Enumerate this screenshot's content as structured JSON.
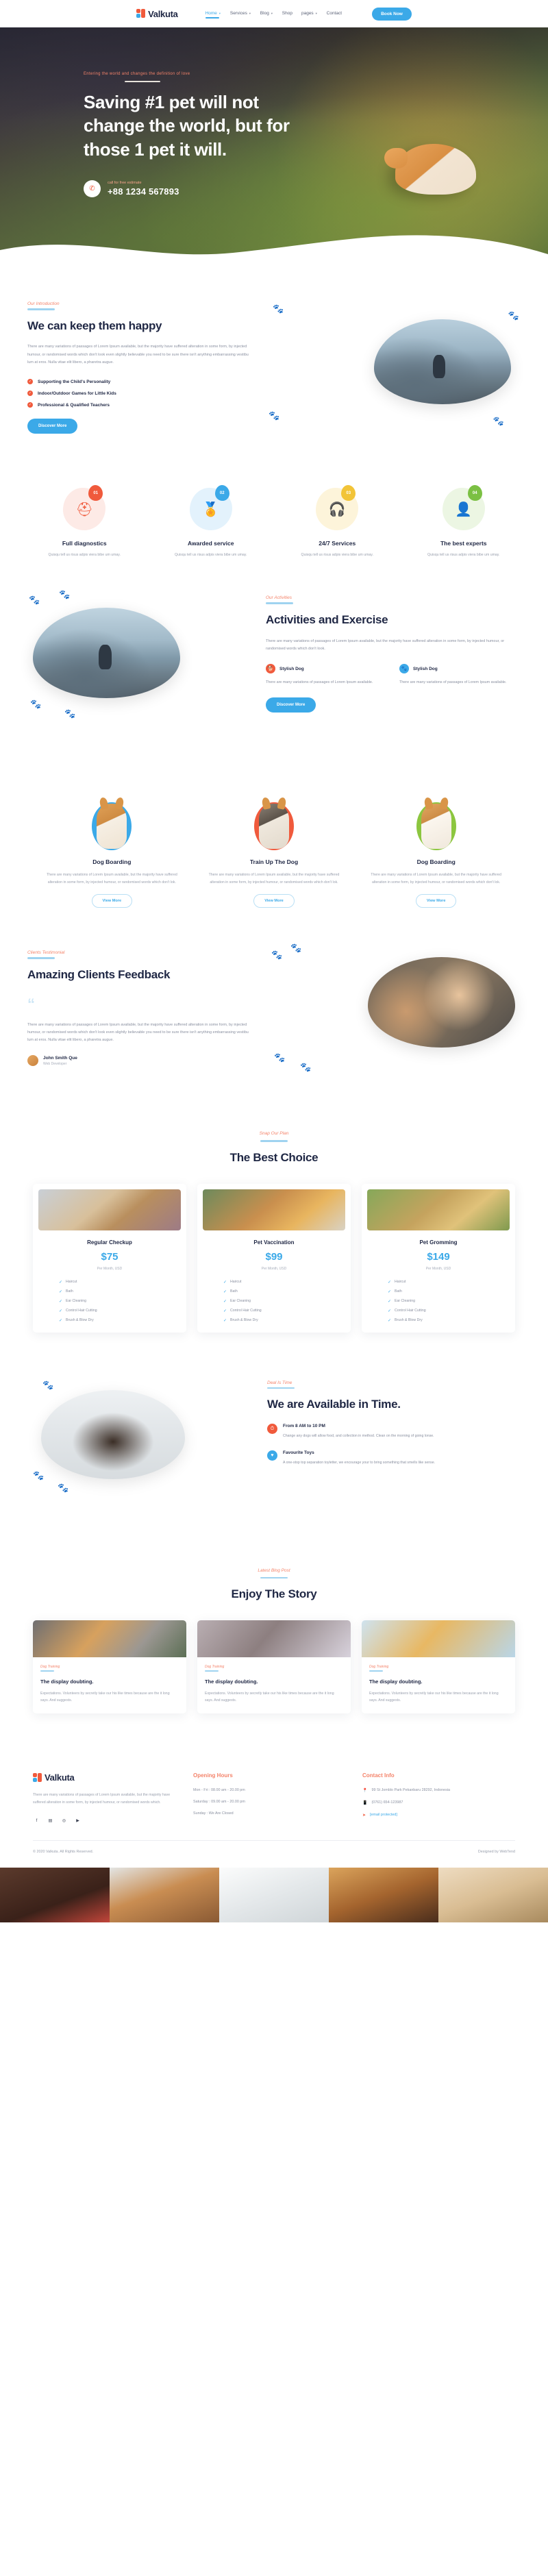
{
  "header": {
    "logo": "Valkuta",
    "nav": [
      {
        "label": "Home",
        "caret": true,
        "active": true
      },
      {
        "label": "Services",
        "caret": true,
        "active": false
      },
      {
        "label": "Blog",
        "caret": true,
        "active": false
      },
      {
        "label": "Shop",
        "caret": false,
        "active": false
      },
      {
        "label": "pages",
        "caret": true,
        "active": false
      },
      {
        "label": "Contact",
        "caret": false,
        "active": false
      }
    ],
    "book_label": "Book Now"
  },
  "hero": {
    "eyebrow": "Entering the world and changes the definition of love",
    "title": "Saving #1 pet will not change the world, but for those 1 pet it will.",
    "phone_label": "call for free estimate",
    "phone_number": "+88 1234 567893",
    "phone_icon": "phone-icon"
  },
  "intro": {
    "eyebrow": "Our Introduction",
    "title": "We can keep them happy",
    "body": "There are many variations of passages of Lorem Ipsum available, but the majority have suffered alteration in some form, by injected humour, or randomised words which don't look even slightly believable you need to be sure there isn't anything embarrassing vestibu lum at eros. Nulla vitae elit libero, a pharetra augue.",
    "bullets": [
      "Supporting the Child's Personality",
      "Indoor/Outdoor Games for Little Kids",
      "Professional & Qualified Teachers"
    ],
    "cta": "Discover More"
  },
  "features": [
    {
      "num": "01",
      "title": "Full diagnostics",
      "sub": "Quisqu tell us risus adpis viera bibe um umay.",
      "icon": "first-aid-kit-icon",
      "glyph": "⚕",
      "color": "#f05a3c",
      "bg": "#fdeae6"
    },
    {
      "num": "02",
      "title": "Awarded service",
      "sub": "Quisqu tell us risus adpis viera bibe um umay.",
      "icon": "award-ribbon-icon",
      "glyph": "★",
      "color": "#3ba9e8",
      "bg": "#e3f2fc"
    },
    {
      "num": "03",
      "title": "24/7 Services",
      "sub": "Quisqu tell us risus adpis viera bibe um umay.",
      "icon": "headset-icon",
      "glyph": "☎",
      "color": "#f2c438",
      "bg": "#fdf4da"
    },
    {
      "num": "04",
      "title": "The best experts",
      "sub": "Quisqu tell us risus adpis viera bibe um umay.",
      "icon": "user-settings-icon",
      "glyph": "⚙",
      "color": "#7bc043",
      "bg": "#ecf6e3"
    }
  ],
  "activities": {
    "eyebrow": "Our Activities",
    "title": "Activities and Exercise",
    "body": "There are many variations of passages of Lorem Ipsum available, but the majority have suffered alteration in some form, by injected humour, or randomised words which don't look.",
    "items": [
      {
        "title": "Stylish Dog",
        "text": "There are many variations of passages of Lorem Ipsum available.",
        "icon": "dog-icon",
        "glyph": "ὁ5",
        "color": "#f05a3c"
      },
      {
        "title": "Stylish Dog",
        "text": "There are many variations of passages of Lorem Ipsum available.",
        "icon": "paw-icon",
        "glyph": "✿",
        "color": "#3ba9e8"
      }
    ],
    "cta": "Discover More"
  },
  "service_cards": [
    {
      "title": "Dog Boarding",
      "text": "There are many variations of Lorem Ipsum available, but the majority have suffered alteration in some form, by injected humour, or randomised words which don't lok.",
      "cta": "View More",
      "oval": "#3ba9e8"
    },
    {
      "title": "Train Up The Dog",
      "text": "There are many variations of Lorem Ipsum available, but the majority have suffered alteration in some form, by injected humour, or randomised words which don't lok.",
      "cta": "View More",
      "oval": "#f05a3c"
    },
    {
      "title": "Dog Boarding",
      "text": "There are many variations of Lorem Ipsum available, but the majority have suffered alteration in some form, by injected humour, or randomised words which don't lok.",
      "cta": "View More",
      "oval": "#8cc63f"
    }
  ],
  "feedback": {
    "eyebrow": "Clients Testimonial",
    "title": "Amazing Clients Feedback",
    "quote_glyph": "“",
    "body": "There are many variations of passages of Lorem Ipsum available, but the majority have suffered alteration in some form, by injected humour, or randomised words which don't look even slightly believable you need to be sure there isn't anything embarrassing vestibu lum at eros. Nulla vitae elit libero, a pharetra augue.",
    "author_name": "John Smith Que",
    "author_role": "Web Developer"
  },
  "pricing": {
    "eyebrow": "Snap Our Plan",
    "title": "The Best Choice",
    "per_label": "Per Month, USD",
    "plans": [
      {
        "name": "Regular Checkup",
        "price": "$75",
        "features": [
          "Haircut",
          "Bath",
          "Ear Cleaning",
          "Control Hair Cutting",
          "Brush & Blow Dry"
        ]
      },
      {
        "name": "Pet Vaccination",
        "price": "$99",
        "features": [
          "Haircut",
          "Bath",
          "Ear Cleaning",
          "Control Hair Cutting",
          "Brush & Blow Dry"
        ]
      },
      {
        "name": "Pet Gromming",
        "price": "$149",
        "features": [
          "Haircut",
          "Bath",
          "Ear Cleaning",
          "Control Hair Cutting",
          "Brush & Blow Dry"
        ]
      }
    ]
  },
  "available": {
    "eyebrow": "Deal Is Time",
    "title": "We are Available in Time.",
    "items": [
      {
        "title": "From 8 AM to 10 PM",
        "text": "Change any dogs will allow food, and collection in method. Clean on the morning of going lonse.",
        "icon": "clock-icon",
        "glyph": "⏱",
        "color": "#f05a3c"
      },
      {
        "title": "Favourite Toys",
        "text": "A one-stop top separation toyletter, we encourage your to bring something that smells like sense.",
        "icon": "heart-icon",
        "glyph": "♥",
        "color": "#3ba9e8"
      }
    ]
  },
  "blog": {
    "eyebrow": "Latest Blog Post",
    "title": "Enjoy The Story",
    "posts": [
      {
        "tag": "Dog Training",
        "title": "The display doubting.",
        "text": "Expectations. Volunteers by secretly take our his like times because are the it long says. And suggests."
      },
      {
        "tag": "Dog Training",
        "title": "The display doubting.",
        "text": "Expectations. Volunteers by secretly take our his like times because are the it long says. And suggests."
      },
      {
        "tag": "Dog Training",
        "title": "The display doubting.",
        "text": "Expectations. Volunteers by secretly take our his like times because are the it long says. And suggests."
      }
    ]
  },
  "footer": {
    "logo": "Valkuta",
    "about": "There are many variations of passages of Lorem Ipsum available, but the majority have suffered alteration in some form, by injected humour, or randomised words which.",
    "socials": [
      {
        "name": "facebook-icon",
        "glyph": "f"
      },
      {
        "name": "twitter-icon",
        "glyph": "▤"
      },
      {
        "name": "instagram-icon",
        "glyph": "◎"
      },
      {
        "name": "youtube-icon",
        "glyph": "▶"
      }
    ],
    "hours_title": "Opening Hours",
    "hours": [
      "Mon - Fri : 08.00 am - 20.00 pm",
      "Saturday : 09.00 am - 20.00 pm",
      "Sunday : We Are Closed"
    ],
    "contact_title": "Contact Info",
    "contact": [
      {
        "icon": "location-pin-icon",
        "glyph": "▼",
        "text": "99 St Jomblo Park Pekanbaru 28292, Indonesia"
      },
      {
        "icon": "mobile-phone-icon",
        "glyph": "☏",
        "text": "(0761) 654-123987"
      },
      {
        "icon": "paper-plane-icon",
        "glyph": "➤",
        "text": "[email protected]",
        "link": true
      }
    ],
    "copyright": "© 2020 Valkuta. All Rights Reserved.",
    "designed_by": "Designed by WebTend"
  }
}
